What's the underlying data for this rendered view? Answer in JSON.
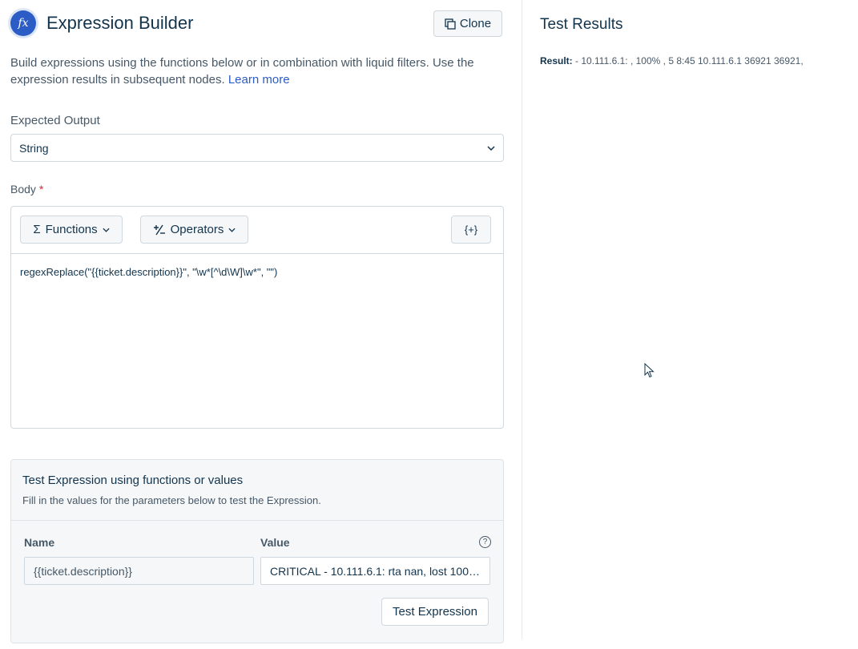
{
  "header": {
    "icon_text": "fx",
    "title": "Expression Builder",
    "clone_label": "Clone"
  },
  "intro": {
    "text": "Build expressions using the functions below or in combination with liquid filters. Use the expression results in subsequent nodes.",
    "link": "Learn more"
  },
  "expected_output": {
    "label": "Expected Output",
    "value": "String"
  },
  "body": {
    "label": "Body",
    "required_mark": "*",
    "functions_label": "Functions",
    "operators_label": "Operators",
    "placeholder_button": "{+}",
    "expression": "regexReplace(\"{{ticket.description}}\", \"\\w*[^\\d\\W]\\w*\", \"\")"
  },
  "test_panel": {
    "title": "Test Expression using functions or values",
    "subtitle": "Fill in the values for the parameters below to test the Expression.",
    "name_header": "Name",
    "value_header": "Value",
    "param_name": "{{ticket.description}}",
    "param_value": "CRITICAL - 10.111.6.1: rta nan, lost 100…",
    "test_button": "Test Expression"
  },
  "results": {
    "title": "Test Results",
    "label": "Result:",
    "value": "- 10.111.6.1: , 100% , 5 8:45 10.111.6.1 36921 36921,"
  },
  "colors": {
    "primary": "#2c5cc5",
    "text": "#12344d",
    "muted": "#475867",
    "border": "#cfd7df",
    "panel_bg": "#f5f7f9",
    "required": "#d72d30"
  }
}
